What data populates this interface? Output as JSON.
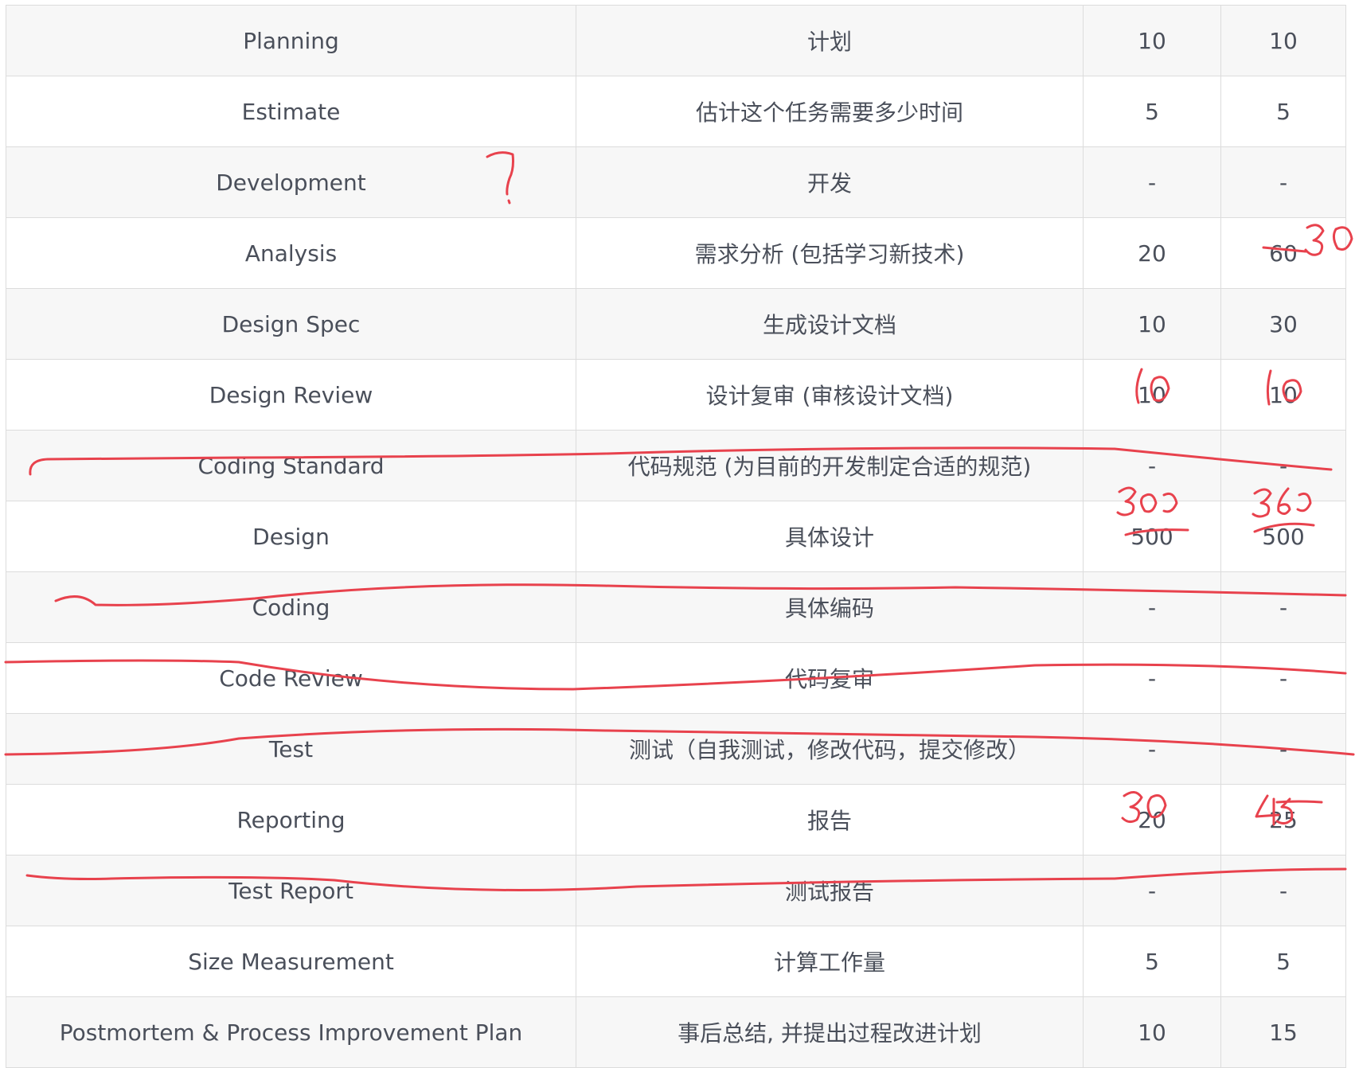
{
  "ink_color": "#e8424d",
  "rows": [
    {
      "activity": "Planning",
      "description": "计划",
      "estimate": "10",
      "actual": "10"
    },
    {
      "activity": "Estimate",
      "description": "估计这个任务需要多少时间",
      "estimate": "5",
      "actual": "5"
    },
    {
      "activity": "Development",
      "description": "开发",
      "estimate": "-",
      "actual": "-"
    },
    {
      "activity": "Analysis",
      "description": "需求分析 (包括学习新技术)",
      "estimate": "20",
      "actual": "60"
    },
    {
      "activity": "Design Spec",
      "description": "生成设计文档",
      "estimate": "10",
      "actual": "30"
    },
    {
      "activity": "Design Review",
      "description": "设计复审 (审核设计文档)",
      "estimate": "10",
      "actual": "10"
    },
    {
      "activity": "Coding Standard",
      "description": "代码规范 (为目前的开发制定合适的规范)",
      "estimate": "-",
      "actual": "-"
    },
    {
      "activity": "Design",
      "description": "具体设计",
      "estimate": "500",
      "actual": "500"
    },
    {
      "activity": "Coding",
      "description": "具体编码",
      "estimate": "-",
      "actual": "-"
    },
    {
      "activity": "Code Review",
      "description": "代码复审",
      "estimate": "-",
      "actual": "-"
    },
    {
      "activity": "Test",
      "description": "测试（自我测试，修改代码，提交修改）",
      "estimate": "-",
      "actual": "-"
    },
    {
      "activity": "Reporting",
      "description": "报告",
      "estimate": "20",
      "actual": "25"
    },
    {
      "activity": "Test Report",
      "description": "测试报告",
      "estimate": "-",
      "actual": "-"
    },
    {
      "activity": "Size Measurement",
      "description": "计算工作量",
      "estimate": "5",
      "actual": "5"
    },
    {
      "activity": "Postmortem & Process Improvement Plan",
      "description": "事后总结, 并提出过程改进计划",
      "estimate": "10",
      "actual": "15"
    }
  ],
  "handwritten_annotations": {
    "development_mark": "?",
    "analysis_actual": "30",
    "design_review_estimate": "10",
    "design_review_actual": "10",
    "design_estimate": "300",
    "design_actual": "360",
    "reporting_estimate": "30",
    "reporting_actual": "45"
  }
}
